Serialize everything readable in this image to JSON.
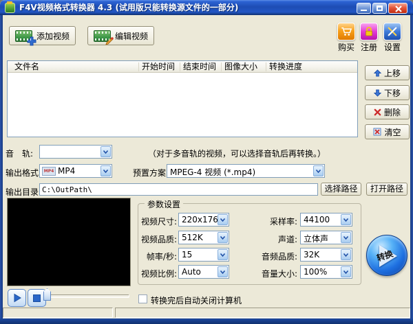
{
  "window": {
    "title": "F4V视频格式转换器 4.3 (试用版只能转换源文件的一部分)"
  },
  "toolbar": {
    "add_video": "添加视频",
    "edit_video": "编辑视频",
    "buy": "购买",
    "register": "注册",
    "settings": "设置"
  },
  "file_table": {
    "columns": [
      "文件名",
      "开始时间",
      "结束时间",
      "图像大小",
      "转换进度"
    ],
    "rows": []
  },
  "list_actions": {
    "move_up": "上移",
    "move_down": "下移",
    "delete": "删除",
    "clear": "清空"
  },
  "audio_track": {
    "label": "音　轨:",
    "value": "",
    "hint": "（对于多音轨的视频，可以选择音轨后再转换。）"
  },
  "output_format": {
    "label": "输出格式:",
    "value": "MP4",
    "icon_text": "MP4",
    "preset_label": "预置方案:",
    "preset_value": "MPEG-4 视频 (*.mp4)"
  },
  "output_dir": {
    "label": "输出目录:",
    "value": "C:\\OutPath\\",
    "choose_button": "选择路径",
    "open_button": "打开路径"
  },
  "params": {
    "title": "参数设置",
    "fields": [
      {
        "label": "视频尺寸:",
        "value": "220x176"
      },
      {
        "label": "视频品质:",
        "value": "512K"
      },
      {
        "label": "帧率/秒:",
        "value": "15"
      },
      {
        "label": "视频比例:",
        "value": "Auto"
      },
      {
        "label": "采样率:",
        "value": "44100"
      },
      {
        "label": "声道:",
        "value": "立体声"
      },
      {
        "label": "音频品质:",
        "value": "32K"
      },
      {
        "label": "音量大小:",
        "value": "100%"
      }
    ]
  },
  "shutdown_checkbox": {
    "label": "转换完后自动关闭计算机",
    "checked": false
  },
  "convert_button": {
    "label": "转换"
  },
  "status_bar": {
    "panel1": "",
    "panel2": ""
  },
  "colors": {
    "titlebar_blue": "#1E4DB4",
    "client_bg": "#ECE9D8",
    "accent_blue": "#2F6BD0",
    "close_red": "#D6492F",
    "buy_orange": "#F7A01B",
    "register_magenta": "#E23BD4",
    "settings_blue": "#2E6FD8",
    "convert_blue": "#1E6FE0"
  }
}
